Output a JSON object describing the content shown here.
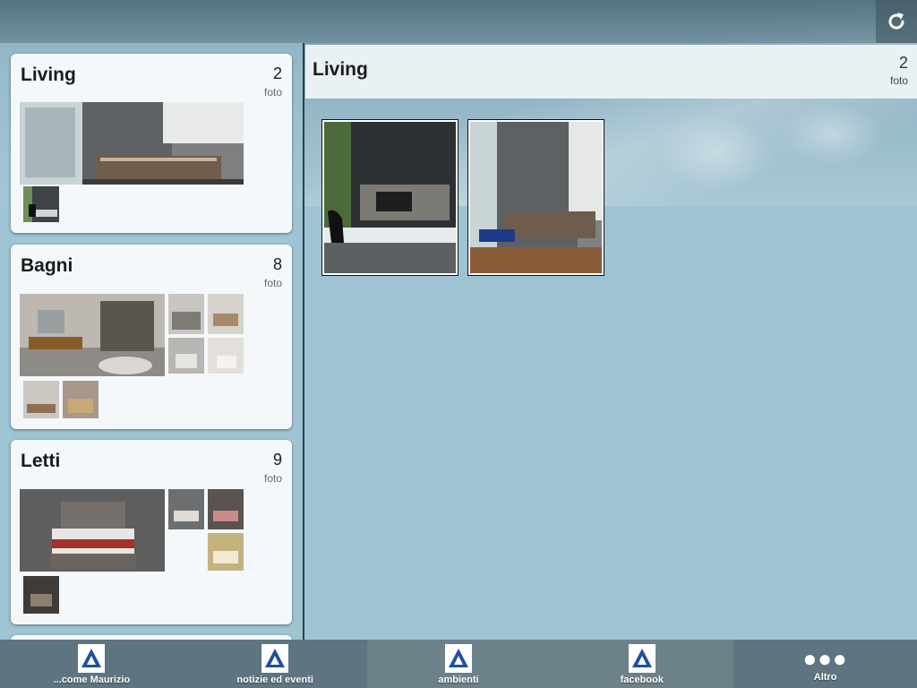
{
  "albums": [
    {
      "title": "Living",
      "count": "2",
      "count_label": "foto"
    },
    {
      "title": "Bagni",
      "count": "8",
      "count_label": "foto"
    },
    {
      "title": "Letti",
      "count": "9",
      "count_label": "foto"
    }
  ],
  "detail": {
    "title": "Living",
    "count": "2",
    "count_label": "foto"
  },
  "tabs": [
    {
      "label": "...come Maurizio",
      "icon": "app-logo-icon"
    },
    {
      "label": "notizie ed eventi",
      "icon": "app-logo-icon"
    },
    {
      "label": "ambienti",
      "icon": "app-logo-icon"
    },
    {
      "label": "facebook",
      "icon": "app-logo-icon"
    },
    {
      "label": "Altro",
      "icon": "more-dots-icon"
    }
  ],
  "colors": {
    "accent": "#5e7480",
    "background": "#9ec4d4",
    "logo_blue": "#1e4fa0"
  }
}
